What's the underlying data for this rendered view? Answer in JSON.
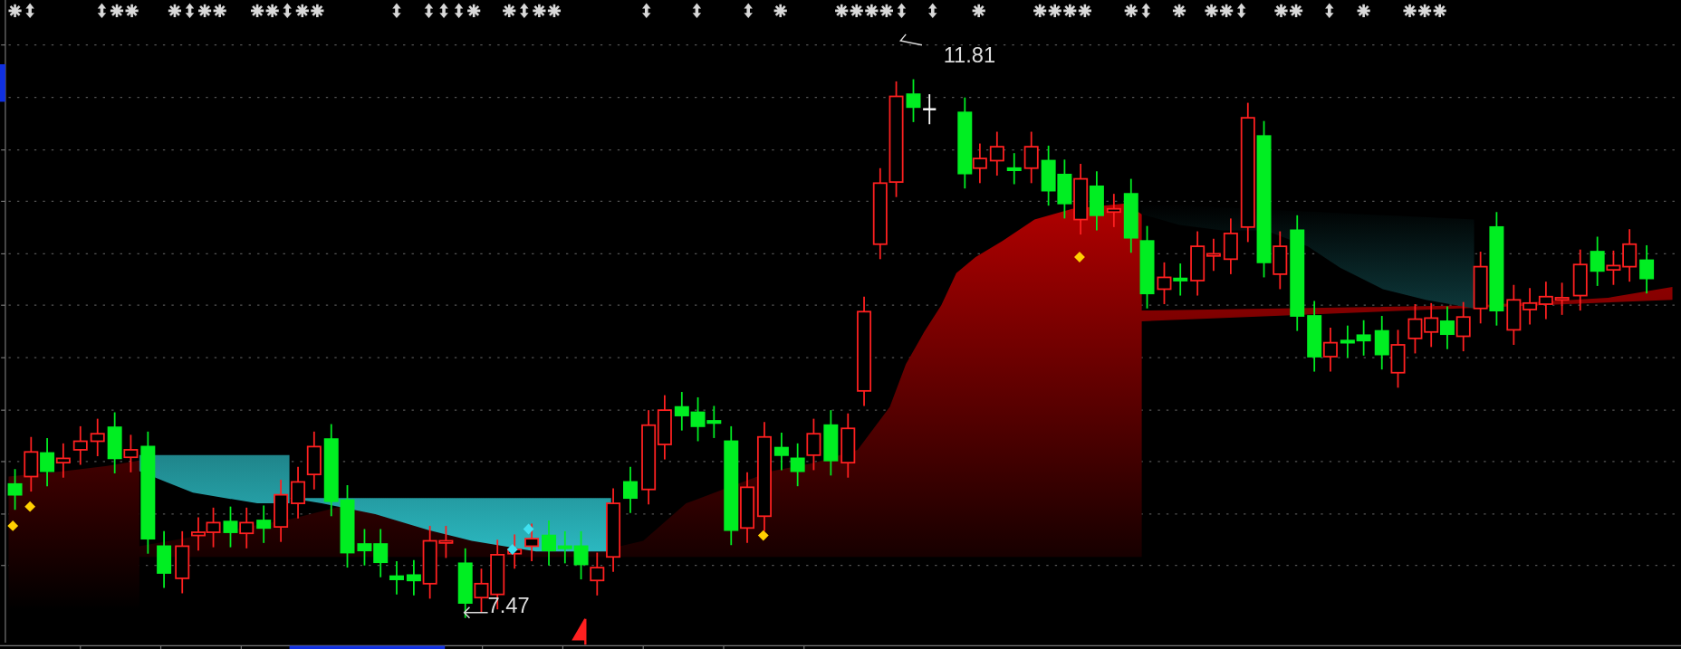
{
  "chart": {
    "high_label": "11.81",
    "low_label": "7.47"
  }
}
